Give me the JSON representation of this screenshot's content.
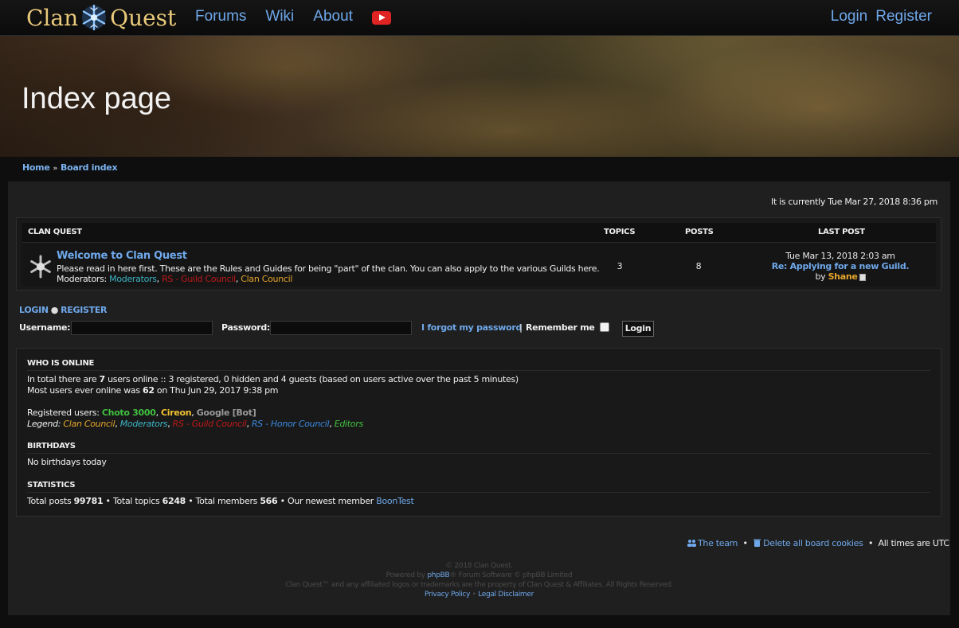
{
  "nav": {
    "logo_word1": "Clan",
    "logo_word2": "Quest",
    "links": [
      "Forums",
      "Wiki",
      "About"
    ],
    "youtube_icon": "youtube-icon",
    "login": "Login",
    "register": "Register"
  },
  "banner": {
    "title": "Index page"
  },
  "breadcrumb": {
    "home": "Home",
    "board_index": "Board index"
  },
  "current_time": "It is currently Tue Mar 27, 2018 8:36 pm",
  "forum_table": {
    "headers": {
      "category": "Clan Quest",
      "topics": "Topics",
      "posts": "Posts",
      "last_post": "Last post"
    },
    "row": {
      "title": "Welcome to Clan Quest",
      "description": "Please read in here first. These are the Rules and Guides for being \"part\" of the clan. You can also apply to the various Guilds here.",
      "moderators_label": "Moderators:",
      "moderators": [
        "Moderators",
        "RS - Guild Council",
        "Clan Council"
      ],
      "topics": "3",
      "posts": "8",
      "last_post_date": "Tue Mar 13, 2018 2:03 am",
      "last_post_topic": "Re: Applying for a new Guild.",
      "last_post_by": "by",
      "last_post_user": "Shane"
    }
  },
  "login_form": {
    "login_link": "Login",
    "register_link": "Register",
    "username_label": "Username:",
    "password_label": "Password:",
    "forgot": "I forgot my password",
    "remember": "Remember me",
    "button": "Login"
  },
  "who_is_online": {
    "title": "Who is online",
    "line1_prefix": "In total there are ",
    "line1_count": "7",
    "line1_suffix": " users online :: 3 registered, 0 hidden and 4 guests (based on users active over the past 5 minutes)",
    "line2_prefix": "Most users ever online was ",
    "line2_count": "62",
    "line2_suffix": " on Thu Jun 29, 2017 9:38 pm",
    "registered_label": "Registered users:",
    "registered_users": [
      "Choto 3000",
      "Cireon",
      "Google [Bot]"
    ],
    "legend_label": "Legend:",
    "legend": [
      "Clan Council",
      "Moderators",
      "RS - Guild Council",
      "RS - Honor Council",
      "Editors"
    ]
  },
  "birthdays": {
    "title": "Birthdays",
    "text": "No birthdays today"
  },
  "statistics": {
    "title": "Statistics",
    "total_posts_label": "Total posts ",
    "total_posts": "99781",
    "total_topics_label": "Total topics ",
    "total_topics": "6248",
    "total_members_label": "Total members ",
    "total_members": "566",
    "newest_label": "Our newest member ",
    "newest_member": "BoonTest"
  },
  "footer": {
    "the_team": "The team",
    "delete_cookies": "Delete all board cookies",
    "timezone": "All times are UTC",
    "copyright": "© 2018 Clan Quest.",
    "powered_prefix": "Powered by ",
    "powered_link": "phpBB",
    "powered_suffix": "® Forum Software © phpBB Limited",
    "trademark": "Clan Quest™ and any affiliated logos or trademarks are the property of Clan Quest & Affiliates. All Rights Reserved.",
    "privacy": "Privacy Policy",
    "legal": "Legal Disclaimer"
  }
}
